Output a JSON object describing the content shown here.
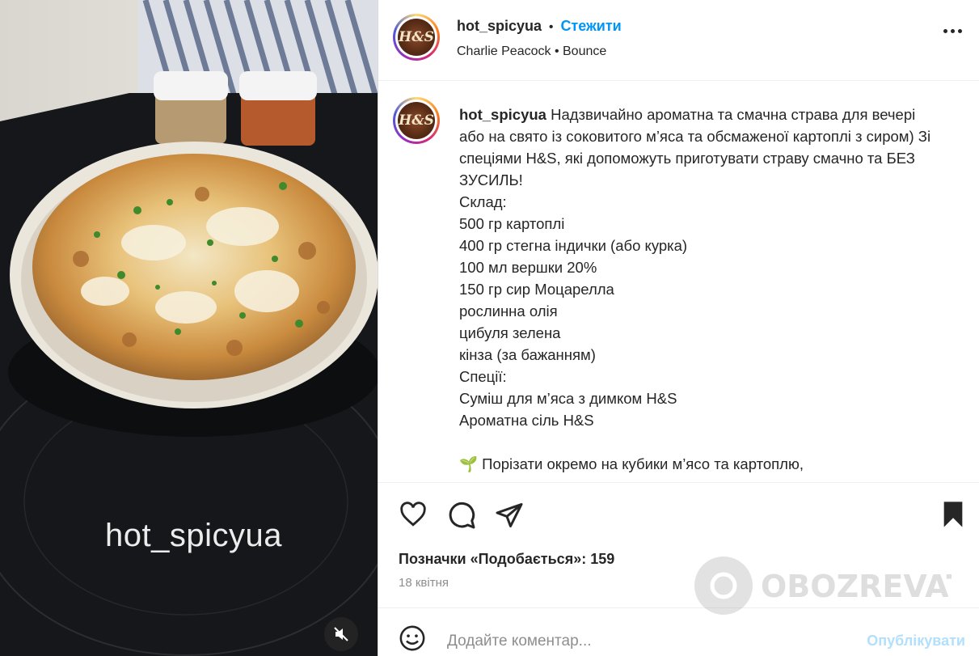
{
  "post": {
    "username": "hot_spicyua",
    "follow_label": "Стежити",
    "audio_artist": "Charlie Peacock",
    "audio_track": "Bounce",
    "avatar_text": "H&S"
  },
  "media": {
    "watermark": "hot_spicyua",
    "mute_icon": "speaker-muted-icon"
  },
  "caption": {
    "username": "hot_spicyua",
    "text": "Надзвичайно ароматна та смачна страва для вечері або на свято із соковитого м’яса та обсмаженої картоплі з сиром) Зі спеціями H&S, які допоможуть приготувати страву смачно та БЕЗ ЗУСИЛЬ!\nСклад:\n500 гр картоплі\n400 гр стегна індички (або курка)\n100 мл вершки 20%\n150 гр сир Моцарелла\nрослинна олія\nцибуля зелена\nкінза (за бажанням)\nСпеції:\nСуміш для м’яса з димком H&S\nАроматна сіль H&S\n\n🌱 Порізати окремо на кубики м’ясо та картоплю,"
  },
  "actions": {
    "likes_text": "Позначки «Подобається»: 159",
    "date": "18 квітня",
    "icons": [
      "heart-icon",
      "comment-icon",
      "share-icon",
      "bookmark-icon"
    ]
  },
  "comment": {
    "placeholder": "Додайте коментар...",
    "publish_label": "Опублікувати"
  },
  "overlay": {
    "brand": "OBOZREVATEL"
  }
}
